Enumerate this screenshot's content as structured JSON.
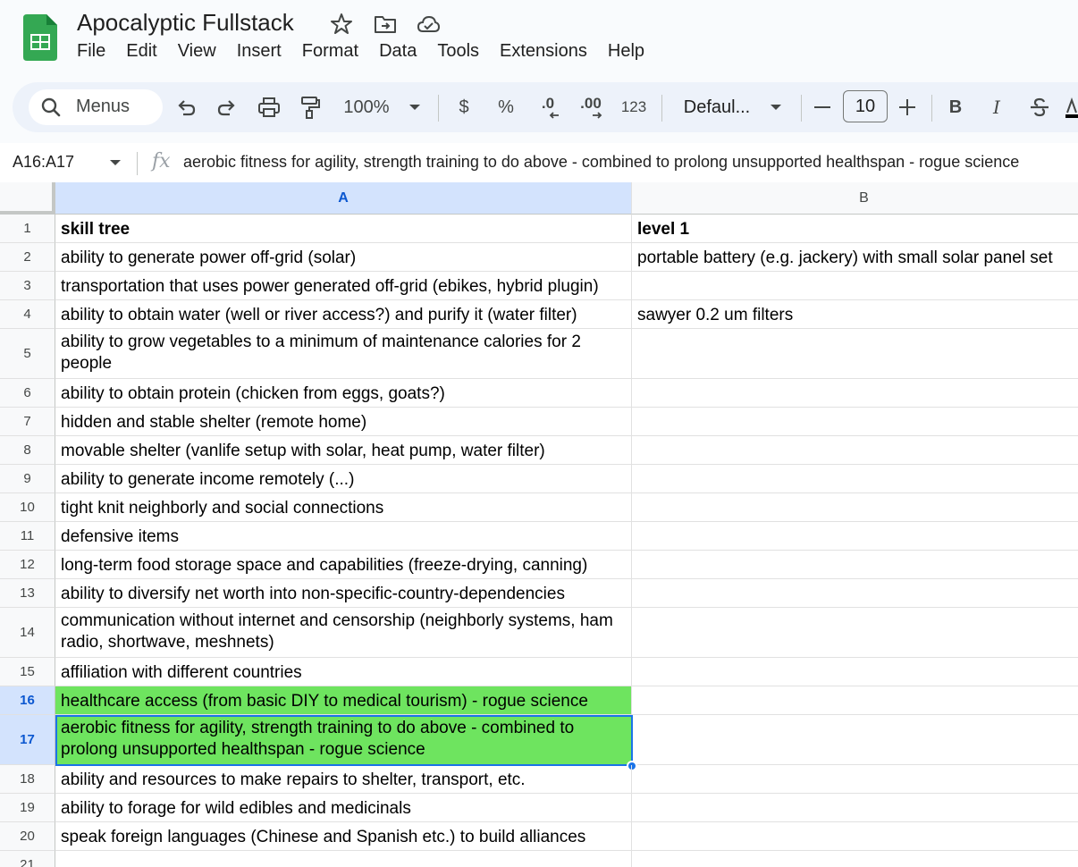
{
  "app": {
    "doc_title": "Apocalyptic Fullstack",
    "menu": [
      "File",
      "Edit",
      "View",
      "Insert",
      "Format",
      "Data",
      "Tools",
      "Extensions",
      "Help"
    ]
  },
  "toolbar": {
    "search_label": "Menus",
    "zoom": "100%",
    "currency": "$",
    "percent": "%",
    "decrease_decimal": ".0",
    "increase_decimal": ".00",
    "number_format": "123",
    "font_name": "Defaul...",
    "font_size": "10",
    "bold": "B",
    "italic": "I"
  },
  "formula_bar": {
    "name_box": "A16:A17",
    "fx": "fx",
    "formula": "aerobic fitness for agility, strength training to do above - combined to prolong unsupported healthspan - rogue science"
  },
  "grid": {
    "columns": [
      "A",
      "B"
    ],
    "rows": [
      {
        "num": "1",
        "a": "skill tree",
        "b": "level 1"
      },
      {
        "num": "2",
        "a": "ability to generate power off-grid (solar)",
        "b": "portable battery (e.g. jackery) with small solar panel set"
      },
      {
        "num": "3",
        "a": "transportation that uses power generated off-grid (ebikes, hybrid plugin)",
        "b": ""
      },
      {
        "num": "4",
        "a": "ability to obtain water (well or river access?) and purify it (water filter)",
        "b": "sawyer 0.2 um filters"
      },
      {
        "num": "5",
        "a": "ability to grow vegetables to a minimum of maintenance calories for 2 people",
        "b": ""
      },
      {
        "num": "6",
        "a": "ability to obtain protein (chicken from eggs, goats?)",
        "b": ""
      },
      {
        "num": "7",
        "a": "hidden and stable shelter (remote home)",
        "b": ""
      },
      {
        "num": "8",
        "a": "movable shelter (vanlife setup with solar, heat pump, water filter)",
        "b": ""
      },
      {
        "num": "9",
        "a": "ability to generate income remotely (...)",
        "b": ""
      },
      {
        "num": "10",
        "a": "tight knit neighborly and social connections",
        "b": ""
      },
      {
        "num": "11",
        "a": "defensive items",
        "b": ""
      },
      {
        "num": "12",
        "a": "long-term food storage space and capabilities (freeze-drying, canning)",
        "b": ""
      },
      {
        "num": "13",
        "a": "ability to diversify net worth into non-specific-country-dependencies",
        "b": ""
      },
      {
        "num": "14",
        "a": "communication without internet and censorship (neighborly systems, ham radio, shortwave, meshnets)",
        "b": ""
      },
      {
        "num": "15",
        "a": "affiliation with different countries",
        "b": ""
      },
      {
        "num": "16",
        "a": "healthcare access (from basic DIY to medical tourism) - rogue science",
        "b": ""
      },
      {
        "num": "17",
        "a": "aerobic fitness for agility, strength training to do above - combined to prolong unsupported healthspan - rogue science",
        "b": ""
      },
      {
        "num": "18",
        "a": "ability and resources to make repairs to shelter, transport, etc.",
        "b": ""
      },
      {
        "num": "19",
        "a": "ability to forage for wild edibles and medicinals",
        "b": ""
      },
      {
        "num": "20",
        "a": "speak foreign languages (Chinese and Spanish etc.) to build alliances",
        "b": ""
      },
      {
        "num": "21",
        "a": "",
        "b": ""
      }
    ],
    "highlight_color": "#6ee45f",
    "selection_color": "#1a73e8"
  }
}
